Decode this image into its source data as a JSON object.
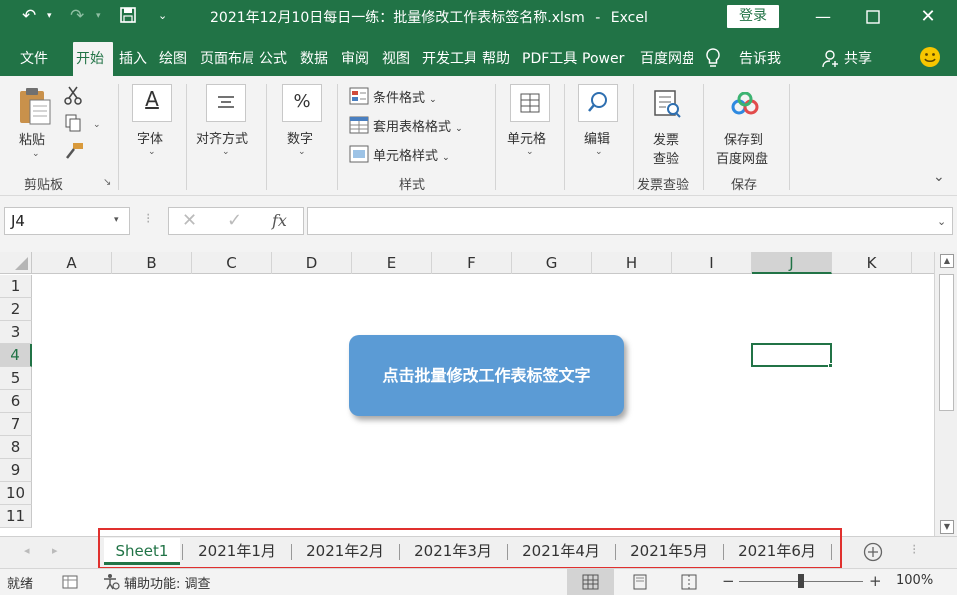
{
  "title_bar": {
    "file_title": "2021年12月10日每日一练：批量修改工作表标签名称.xlsm",
    "separator": "-",
    "app_name": "Excel",
    "login_label": "登录"
  },
  "menu": {
    "tabs": [
      "文件",
      "开始",
      "插入",
      "绘图",
      "页面布局",
      "公式",
      "数据",
      "审阅",
      "视图",
      "开发工具",
      "帮助",
      "PDF工具",
      "Power",
      "百度网盘"
    ],
    "active_tab": "开始",
    "tell_me": "告诉我",
    "share": "共享"
  },
  "ribbon": {
    "paste_label": "粘贴",
    "clipboard_group": "剪贴板",
    "font_label": "字体",
    "align_label": "对齐方式",
    "number_label": "数字",
    "conditional_format": "条件格式",
    "table_format": "套用表格格式",
    "cell_style": "单元格样式",
    "styles_group": "样式",
    "cells_label": "单元格",
    "edit_label": "编辑",
    "invoice_label_1": "发票",
    "invoice_label_2": "查验",
    "invoice_group": "发票查验",
    "save_baidu_1": "保存到",
    "save_baidu_2": "百度网盘",
    "save_group": "保存",
    "font_icon_glyph": "A",
    "number_icon_glyph": "%"
  },
  "formula_bar": {
    "name_box": "J4",
    "fx_glyph": "fx",
    "formula_value": ""
  },
  "grid": {
    "columns": [
      "A",
      "B",
      "C",
      "D",
      "E",
      "F",
      "G",
      "H",
      "I",
      "J",
      "K"
    ],
    "rows": [
      "1",
      "2",
      "3",
      "4",
      "5",
      "6",
      "7",
      "8",
      "9",
      "10",
      "11"
    ],
    "selected_column": "J",
    "selected_row": "4"
  },
  "callout": {
    "text": "点击批量修改工作表标签文字",
    "fill_color": "#5b9bd5"
  },
  "sheet_tabs": {
    "tabs": [
      "Sheet1",
      "2021年1月",
      "2021年2月",
      "2021年3月",
      "2021年4月",
      "2021年5月",
      "2021年6月"
    ],
    "active": "Sheet1",
    "highlight_color": "#e0302e"
  },
  "status_bar": {
    "ready": "就绪",
    "accessibility": "辅助功能: 调查",
    "zoom": "100%",
    "minus": "−",
    "plus": "+"
  },
  "colors": {
    "brand_green": "#217346",
    "ribbon_bg": "#f3f3f3",
    "selection_green": "#217346"
  }
}
